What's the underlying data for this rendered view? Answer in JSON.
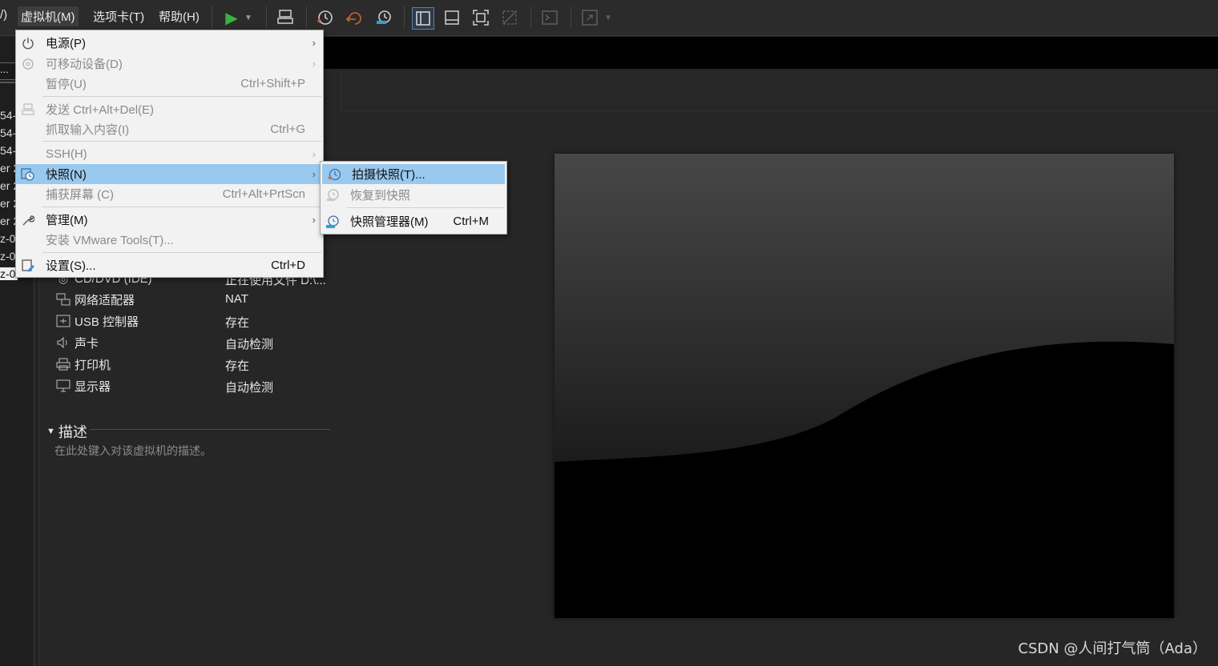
{
  "menubar": {
    "cut_left": "/)",
    "vm": "虚拟机(M)",
    "tabs": "选项卡(T)",
    "help": "帮助(H)"
  },
  "library_fragments": [
    "...",
    "54-",
    "54-",
    "54-",
    "er 2",
    "er 2",
    "er 2",
    "er 2",
    "z-0",
    "z-0",
    "z-0"
  ],
  "vm_menu": {
    "items": [
      {
        "label": "电源(P)",
        "shortcut": "",
        "submenu": true,
        "disabled": false,
        "icon": "power-icon"
      },
      {
        "label": "可移动设备(D)",
        "shortcut": "",
        "submenu": true,
        "disabled": true,
        "icon": "removable-device-icon"
      },
      {
        "label": "暂停(U)",
        "shortcut": "Ctrl+Shift+P",
        "submenu": false,
        "disabled": true,
        "icon": ""
      },
      {
        "label": "发送 Ctrl+Alt+Del(E)",
        "shortcut": "",
        "submenu": false,
        "disabled": true,
        "icon": "send-keys-icon"
      },
      {
        "label": "抓取输入内容(I)",
        "shortcut": "Ctrl+G",
        "submenu": false,
        "disabled": true,
        "icon": ""
      },
      {
        "label": "SSH(H)",
        "shortcut": "",
        "submenu": true,
        "disabled": true,
        "icon": ""
      },
      {
        "label": "快照(N)",
        "shortcut": "",
        "submenu": true,
        "disabled": false,
        "icon": "snapshot-icon"
      },
      {
        "label": "捕获屏幕 (C)",
        "shortcut": "Ctrl+Alt+PrtScn",
        "submenu": false,
        "disabled": true,
        "icon": ""
      },
      {
        "label": "管理(M)",
        "shortcut": "",
        "submenu": true,
        "disabled": false,
        "icon": "wrench-icon"
      },
      {
        "label": "安装 VMware Tools(T)...",
        "shortcut": "",
        "submenu": false,
        "disabled": true,
        "icon": ""
      },
      {
        "label": "设置(S)...",
        "shortcut": "Ctrl+D",
        "submenu": false,
        "disabled": false,
        "icon": "settings-icon"
      }
    ]
  },
  "snapshot_menu": {
    "items": [
      {
        "label": "拍摄快照(T)...",
        "shortcut": "",
        "disabled": false,
        "icon": "take-snapshot-icon"
      },
      {
        "label": "恢复到快照",
        "shortcut": "",
        "disabled": true,
        "icon": "revert-snapshot-icon"
      },
      {
        "label": "快照管理器(M)",
        "shortcut": "Ctrl+M",
        "disabled": false,
        "icon": "snapshot-manager-icon"
      }
    ]
  },
  "devices": [
    {
      "name": "CD/DVD (IDE)",
      "value": "正在使用文件 D:\\...",
      "icon": "cd-icon"
    },
    {
      "name": "网络适配器",
      "value": "NAT",
      "icon": "network-icon"
    },
    {
      "name": "USB 控制器",
      "value": "存在",
      "icon": "usb-icon"
    },
    {
      "name": "声卡",
      "value": "自动检测",
      "icon": "sound-icon"
    },
    {
      "name": "打印机",
      "value": "存在",
      "icon": "printer-icon"
    },
    {
      "name": "显示器",
      "value": "自动检测",
      "icon": "monitor-icon"
    }
  ],
  "description": {
    "title": "描述",
    "placeholder": "在此处键入对该虚拟机的描述。"
  },
  "watermark": "CSDN @人间打气筒（Ada）",
  "colors": {
    "menu_highlight": "#99c9ef",
    "play_green": "#3cb043",
    "background": "#232323"
  }
}
